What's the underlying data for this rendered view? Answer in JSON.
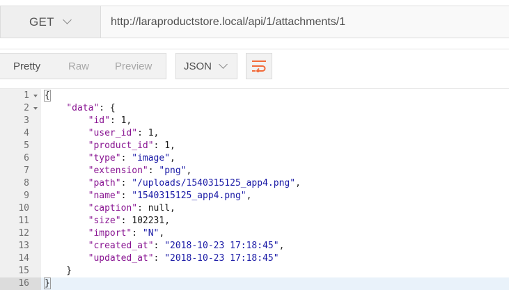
{
  "request": {
    "method": "GET",
    "url": "http://laraproductstore.local/api/1/attachments/1"
  },
  "view_tabs": [
    {
      "label": "Pretty",
      "active": true
    },
    {
      "label": "Raw",
      "active": false
    },
    {
      "label": "Preview",
      "active": false
    }
  ],
  "format": "JSON",
  "icons": {
    "method_dropdown": "chevron-down-icon",
    "format_dropdown": "chevron-down-icon",
    "wrap": "wrap-lines-icon"
  },
  "colors": {
    "accent": "#f26b3a",
    "key": "#881391",
    "string": "#1a1aa6"
  },
  "code": {
    "current_line": 16,
    "lines": [
      {
        "n": "1",
        "fold": true,
        "parts": [
          {
            "t": "{",
            "c": "p",
            "hl": true
          }
        ]
      },
      {
        "n": "2",
        "fold": true,
        "parts": [
          {
            "t": "    ",
            "c": "p"
          },
          {
            "t": "\"data\"",
            "c": "k"
          },
          {
            "t": ": {",
            "c": "p"
          }
        ]
      },
      {
        "n": "3",
        "parts": [
          {
            "t": "        ",
            "c": "p"
          },
          {
            "t": "\"id\"",
            "c": "k"
          },
          {
            "t": ": 1,",
            "c": "p"
          }
        ]
      },
      {
        "n": "4",
        "parts": [
          {
            "t": "        ",
            "c": "p"
          },
          {
            "t": "\"user_id\"",
            "c": "k"
          },
          {
            "t": ": 1,",
            "c": "p"
          }
        ]
      },
      {
        "n": "5",
        "parts": [
          {
            "t": "        ",
            "c": "p"
          },
          {
            "t": "\"product_id\"",
            "c": "k"
          },
          {
            "t": ": 1,",
            "c": "p"
          }
        ]
      },
      {
        "n": "6",
        "parts": [
          {
            "t": "        ",
            "c": "p"
          },
          {
            "t": "\"type\"",
            "c": "k"
          },
          {
            "t": ": ",
            "c": "p"
          },
          {
            "t": "\"image\"",
            "c": "s"
          },
          {
            "t": ",",
            "c": "p"
          }
        ]
      },
      {
        "n": "7",
        "parts": [
          {
            "t": "        ",
            "c": "p"
          },
          {
            "t": "\"extension\"",
            "c": "k"
          },
          {
            "t": ": ",
            "c": "p"
          },
          {
            "t": "\"png\"",
            "c": "s"
          },
          {
            "t": ",",
            "c": "p"
          }
        ]
      },
      {
        "n": "8",
        "parts": [
          {
            "t": "        ",
            "c": "p"
          },
          {
            "t": "\"path\"",
            "c": "k"
          },
          {
            "t": ": ",
            "c": "p"
          },
          {
            "t": "\"/uploads/1540315125_app4.png\"",
            "c": "s"
          },
          {
            "t": ",",
            "c": "p"
          }
        ]
      },
      {
        "n": "9",
        "parts": [
          {
            "t": "        ",
            "c": "p"
          },
          {
            "t": "\"name\"",
            "c": "k"
          },
          {
            "t": ": ",
            "c": "p"
          },
          {
            "t": "\"1540315125_app4.png\"",
            "c": "s"
          },
          {
            "t": ",",
            "c": "p"
          }
        ]
      },
      {
        "n": "10",
        "parts": [
          {
            "t": "        ",
            "c": "p"
          },
          {
            "t": "\"caption\"",
            "c": "k"
          },
          {
            "t": ": null,",
            "c": "p"
          }
        ]
      },
      {
        "n": "11",
        "parts": [
          {
            "t": "        ",
            "c": "p"
          },
          {
            "t": "\"size\"",
            "c": "k"
          },
          {
            "t": ": 102231,",
            "c": "p"
          }
        ]
      },
      {
        "n": "12",
        "parts": [
          {
            "t": "        ",
            "c": "p"
          },
          {
            "t": "\"import\"",
            "c": "k"
          },
          {
            "t": ": ",
            "c": "p"
          },
          {
            "t": "\"N\"",
            "c": "s"
          },
          {
            "t": ",",
            "c": "p"
          }
        ]
      },
      {
        "n": "13",
        "parts": [
          {
            "t": "        ",
            "c": "p"
          },
          {
            "t": "\"created_at\"",
            "c": "k"
          },
          {
            "t": ": ",
            "c": "p"
          },
          {
            "t": "\"2018-10-23 17:18:45\"",
            "c": "s"
          },
          {
            "t": ",",
            "c": "p"
          }
        ]
      },
      {
        "n": "14",
        "parts": [
          {
            "t": "        ",
            "c": "p"
          },
          {
            "t": "\"updated_at\"",
            "c": "k"
          },
          {
            "t": ": ",
            "c": "p"
          },
          {
            "t": "\"2018-10-23 17:18:45\"",
            "c": "s"
          }
        ]
      },
      {
        "n": "15",
        "parts": [
          {
            "t": "    }",
            "c": "p"
          }
        ]
      },
      {
        "n": "16",
        "parts": [
          {
            "t": "}",
            "c": "p",
            "hl": true
          }
        ]
      }
    ]
  }
}
